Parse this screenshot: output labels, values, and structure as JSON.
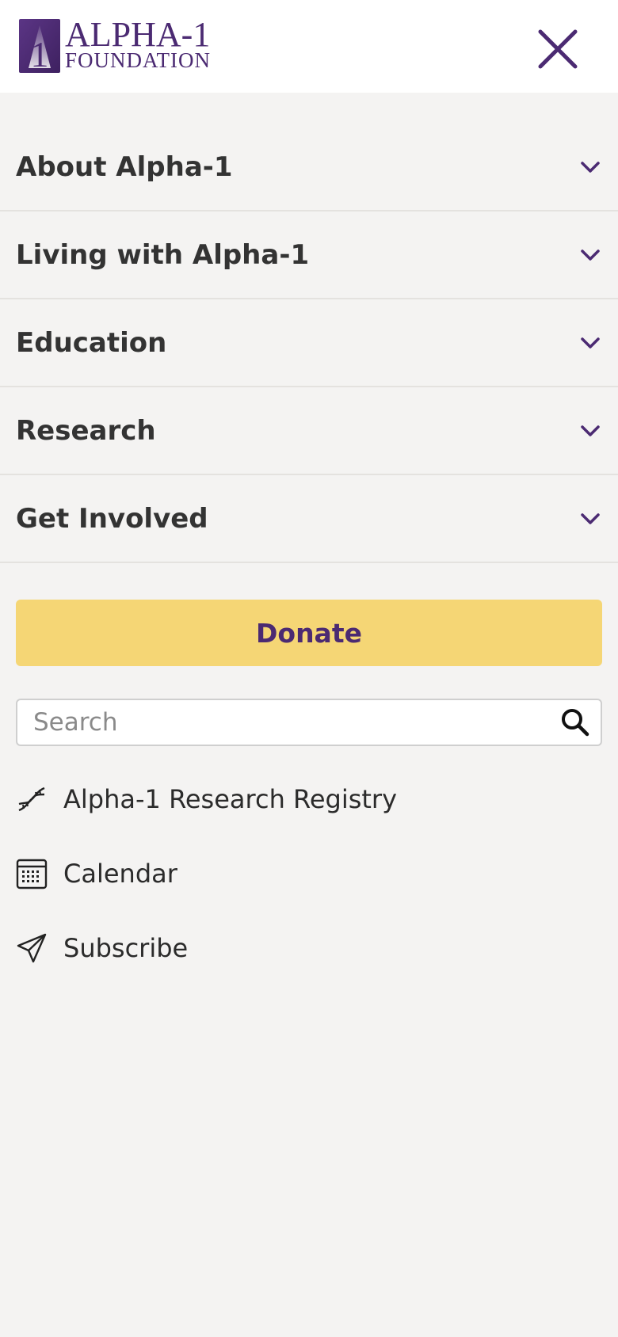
{
  "brand": {
    "name_line1": "ALPHA-1",
    "name_line2": "FOUNDATION",
    "mark_numeral": "1",
    "color": "#4b2a72"
  },
  "header": {
    "close_icon": "close-icon"
  },
  "nav": {
    "items": [
      {
        "label": "About Alpha-1",
        "icon": "chevron-down-icon"
      },
      {
        "label": "Living with Alpha-1",
        "icon": "chevron-down-icon"
      },
      {
        "label": "Education",
        "icon": "chevron-down-icon"
      },
      {
        "label": "Research",
        "icon": "chevron-down-icon"
      },
      {
        "label": "Get Involved",
        "icon": "chevron-down-icon"
      }
    ]
  },
  "donate": {
    "label": "Donate",
    "background": "#f5d675",
    "text_color": "#4b2a72"
  },
  "search": {
    "placeholder": "Search",
    "value": "",
    "icon": "search-icon"
  },
  "quick_links": [
    {
      "label": "Alpha-1 Research Registry",
      "icon": "dna-icon"
    },
    {
      "label": "Calendar",
      "icon": "calendar-icon"
    },
    {
      "label": "Subscribe",
      "icon": "paper-plane-icon"
    }
  ],
  "colors": {
    "page_background": "#f4f3f2",
    "header_background": "#ffffff",
    "accent": "#4b2a72"
  }
}
